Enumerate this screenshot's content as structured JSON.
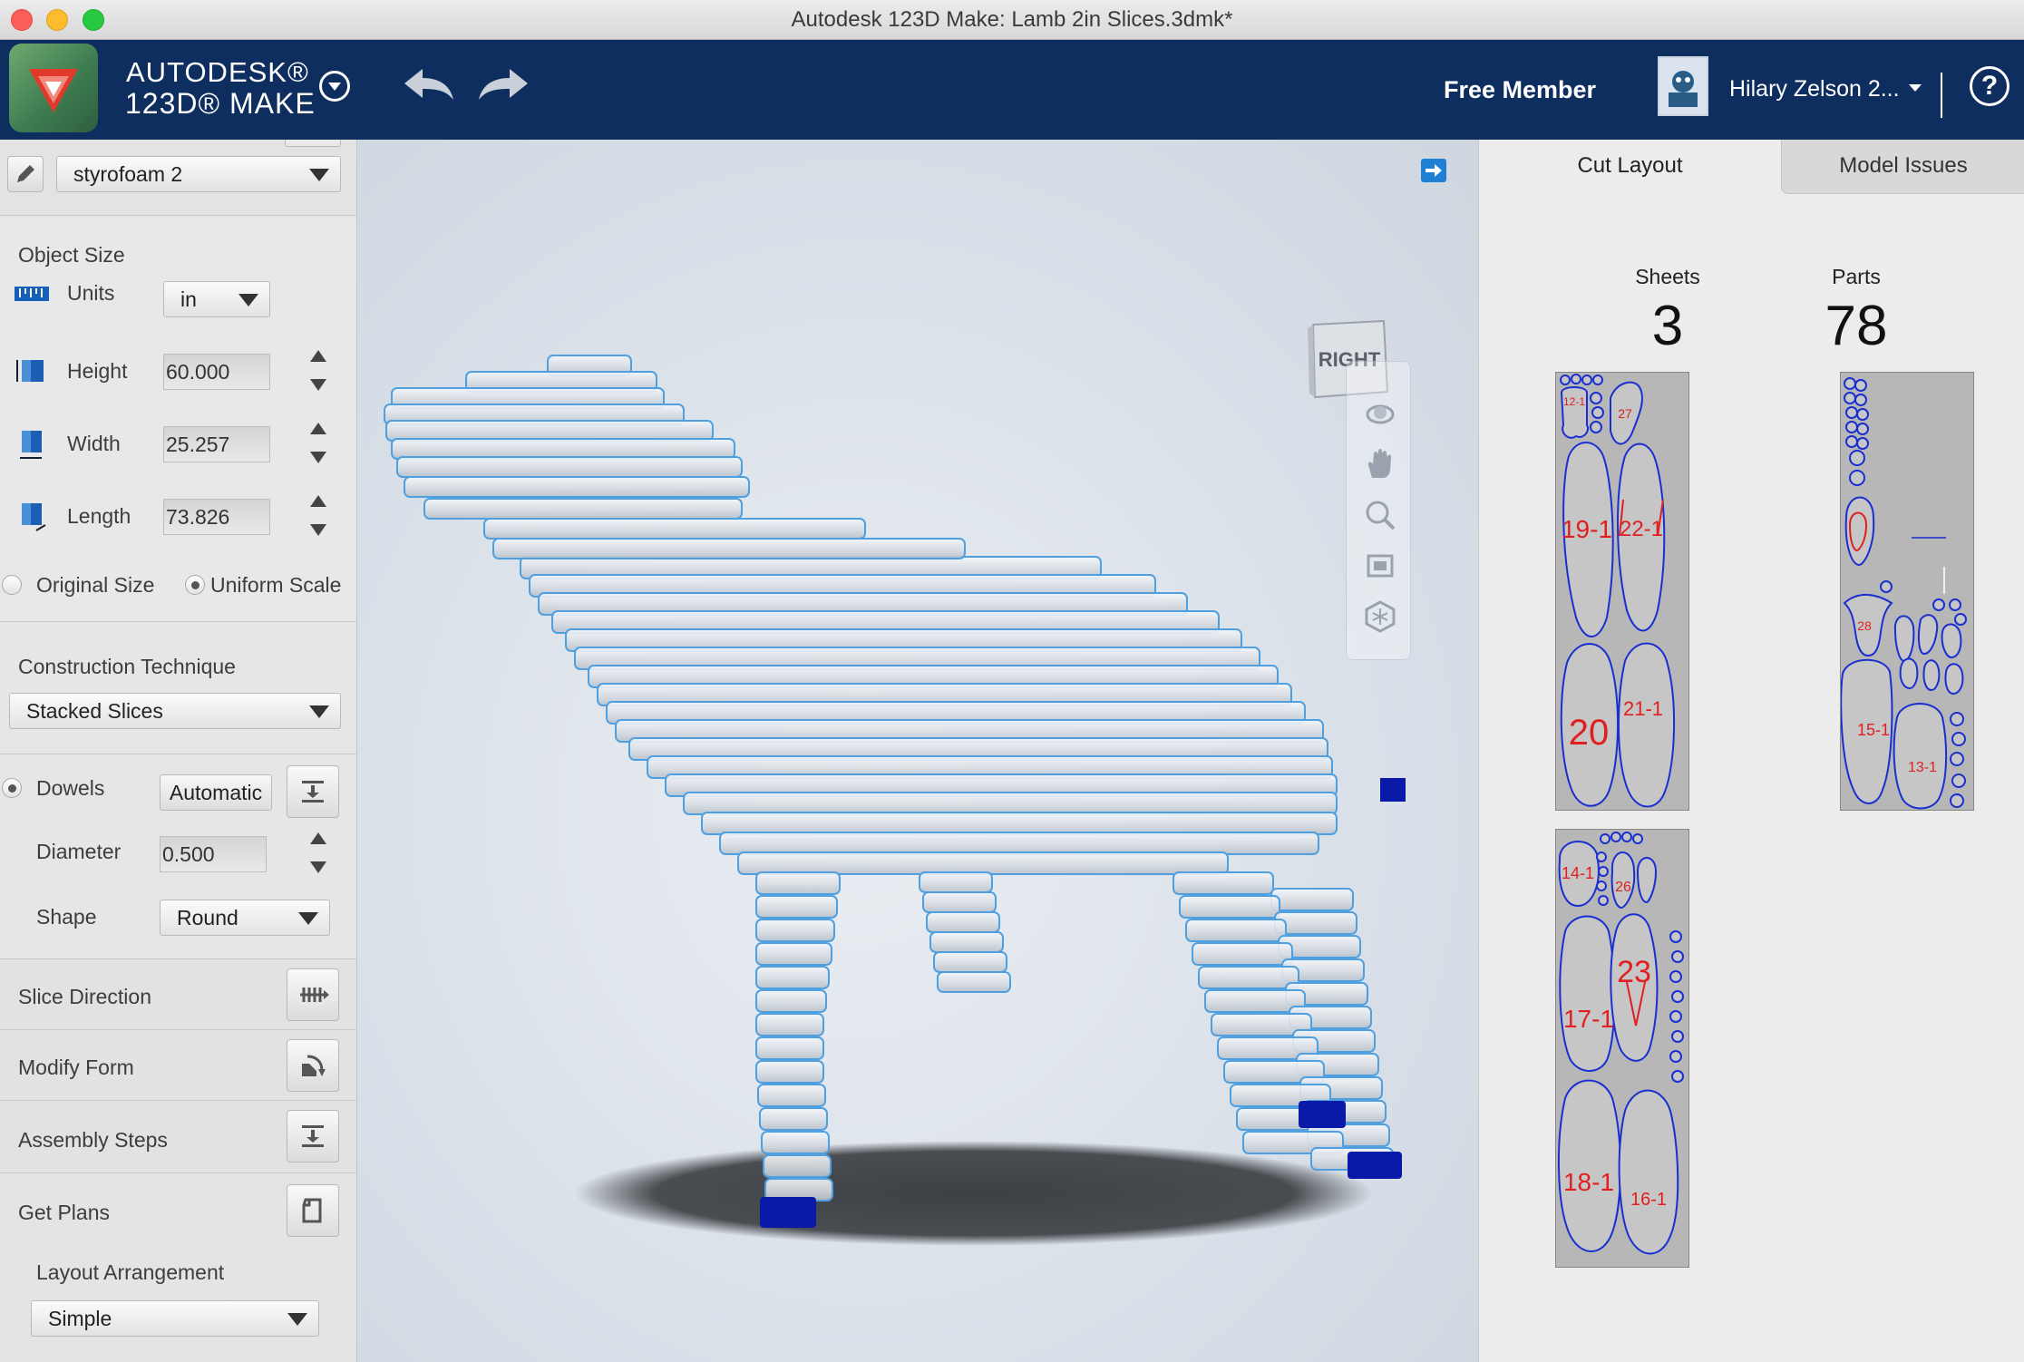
{
  "window": {
    "title": "Autodesk 123D Make: Lamb 2in Slices.3dmk*"
  },
  "header": {
    "brand_line1": "AUTODESK®",
    "brand_line2": "123D® MAKE",
    "member_label": "Free Member",
    "user_name": "Hilary Zelson 2..."
  },
  "left_panel": {
    "material": "styrofoam 2",
    "object_size": {
      "heading": "Object Size",
      "units_label": "Units",
      "units_value": "in",
      "height_label": "Height",
      "height_value": "60.000",
      "width_label": "Width",
      "width_value": "25.257",
      "length_label": "Length",
      "length_value": "73.826",
      "original_size_label": "Original Size",
      "uniform_scale_label": "Uniform Scale"
    },
    "construction": {
      "heading": "Construction Technique",
      "technique": "Stacked Slices"
    },
    "dowels": {
      "label": "Dowels",
      "mode": "Automatic",
      "diameter_label": "Diameter",
      "diameter_value": "0.500",
      "shape_label": "Shape",
      "shape_value": "Round"
    },
    "sections": {
      "slice_direction": "Slice Direction",
      "modify_form": "Modify Form",
      "assembly_steps": "Assembly Steps",
      "get_plans": "Get Plans"
    },
    "layout": {
      "label": "Layout Arrangement",
      "value": "Simple"
    }
  },
  "viewport": {
    "view_cube_face": "RIGHT",
    "nav_icons": [
      "orbit-icon",
      "pan-hand-icon",
      "zoom-icon",
      "fit-view-icon",
      "explode-icon"
    ]
  },
  "right_panel": {
    "tabs": [
      "Cut Layout",
      "Model Issues"
    ],
    "sheets_label": "Sheets",
    "sheets_count": "3",
    "parts_label": "Parts",
    "parts_count": "78",
    "sheet1_labels": [
      "12-1",
      "27",
      "19-1",
      "22-1",
      "20",
      "21-1"
    ],
    "sheet2_labels": [
      "14-1",
      "26",
      "17-1",
      "23",
      "18-1",
      "16-1"
    ],
    "sheet3_labels": [
      "28",
      "15-1",
      "13-1"
    ]
  },
  "colors": {
    "header_bg": "#0d2e5e",
    "accent_blue": "#1e7fd4",
    "part_outline": "#1a2fd0",
    "part_label": "#e02020",
    "dowel_blue": "#0a1aa8"
  }
}
